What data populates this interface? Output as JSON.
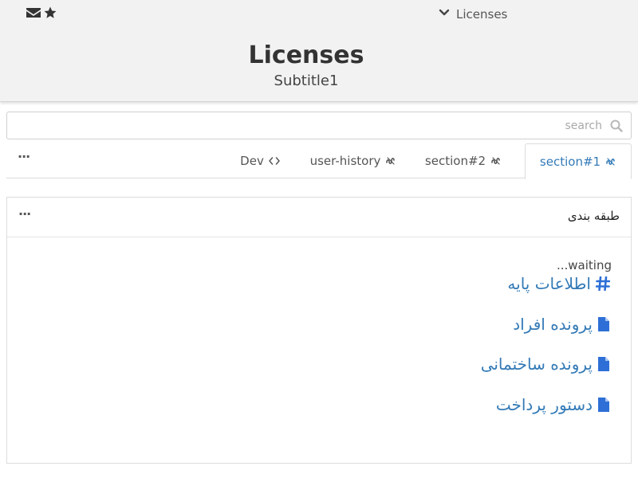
{
  "header": {
    "icons": [
      "envelope-icon",
      "star-icon"
    ],
    "nav_label": "Licenses",
    "title": "Licenses",
    "subtitle": "Subtitle1"
  },
  "search": {
    "placeholder": "search",
    "value": ""
  },
  "tabs": [
    {
      "label": "section#1",
      "icon": "api-icon",
      "active": true
    },
    {
      "label": "section#2",
      "icon": "api-icon",
      "active": false
    },
    {
      "label": "user-history",
      "icon": "api-icon",
      "active": false
    },
    {
      "label": "Dev",
      "icon": "code-icon",
      "active": false
    }
  ],
  "tabs_more": "···",
  "panel": {
    "title": "طبقه بندی",
    "more": "···",
    "status": "...waiting",
    "items": [
      {
        "label": "اطلاعات پایه",
        "icon": "hashtag-icon"
      },
      {
        "label": "پرونده افراد",
        "icon": "file-icon"
      },
      {
        "label": "پرونده ساختمانی",
        "icon": "file-icon"
      },
      {
        "label": "دستور پرداخت",
        "icon": "file-icon"
      }
    ]
  },
  "colors": {
    "accent": "#337ab7",
    "link_icon": "#2d6fd6",
    "header_bg": "#f2f2f2",
    "border": "#dcdcdc"
  }
}
